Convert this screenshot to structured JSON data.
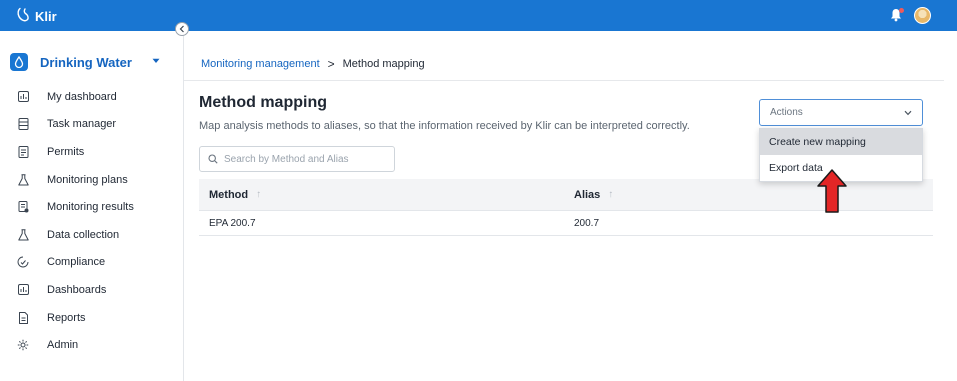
{
  "topbar": {
    "brand": "Klir",
    "brand_icon": "klir-logo-icon",
    "bell_icon": "bell-icon",
    "notification_color": "#f05a5a",
    "accent": "#1976d2"
  },
  "workspace": {
    "name": "Drinking Water",
    "icon": "water-drop-icon"
  },
  "sidebar": {
    "items": [
      {
        "label": "My dashboard",
        "icon": "dashboard-icon"
      },
      {
        "label": "Task manager",
        "icon": "task-manager-icon"
      },
      {
        "label": "Permits",
        "icon": "permits-icon"
      },
      {
        "label": "Monitoring plans",
        "icon": "flask-icon"
      },
      {
        "label": "Monitoring results",
        "icon": "results-icon"
      },
      {
        "label": "Data collection",
        "icon": "flask-icon"
      },
      {
        "label": "Compliance",
        "icon": "compliance-icon"
      },
      {
        "label": "Dashboards",
        "icon": "dashboard-icon"
      },
      {
        "label": "Reports",
        "icon": "reports-icon"
      },
      {
        "label": "Admin",
        "icon": "gear-icon"
      }
    ]
  },
  "breadcrumb": {
    "parent": "Monitoring management",
    "separator": ">",
    "current": "Method mapping"
  },
  "page": {
    "title": "Method mapping",
    "subtitle": "Map analysis methods to aliases, so that the information received by Klir can be interpreted correctly."
  },
  "search": {
    "placeholder": "Search by Method and Alias",
    "value": ""
  },
  "table": {
    "columns": [
      {
        "label": "Method"
      },
      {
        "label": "Alias"
      }
    ],
    "rows": [
      {
        "method": "EPA 200.7",
        "alias": "200.7"
      }
    ]
  },
  "actions": {
    "placeholder": "Actions",
    "menu": [
      {
        "label": "Create new mapping",
        "highlighted": true
      },
      {
        "label": "Export data",
        "highlighted": false
      }
    ]
  },
  "annotation": {
    "arrow_color": "#e32626"
  }
}
